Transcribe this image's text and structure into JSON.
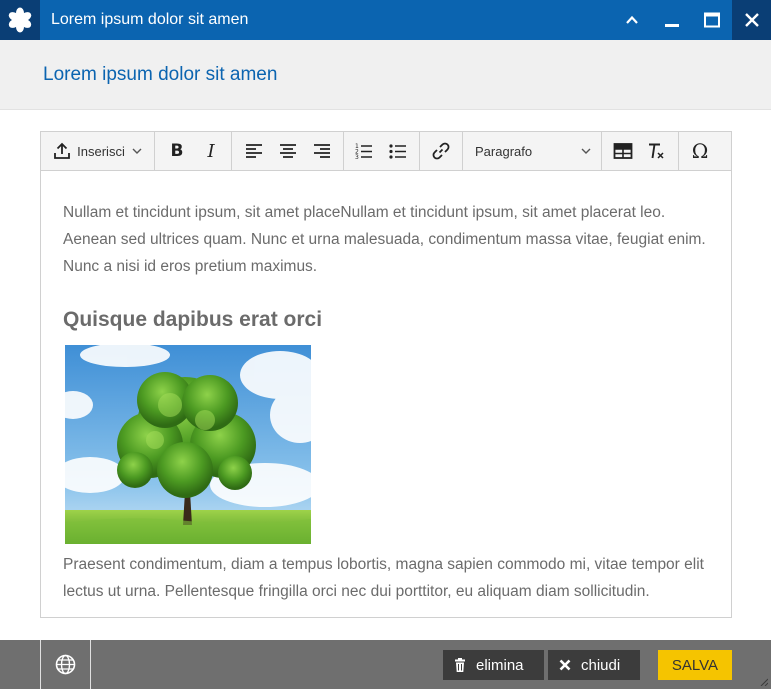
{
  "window": {
    "title": "Lorem ipsum dolor sit amen",
    "logo_icon": "asterisk-logo-icon",
    "controls": [
      "chevron-up-icon",
      "minimize-icon",
      "maximize-icon",
      "close-icon"
    ]
  },
  "header": {
    "title": "Lorem ipsum dolor sit amen"
  },
  "toolbar": {
    "insert_label": "Inserisci",
    "format_label": "Paragrafo"
  },
  "content": {
    "paragraph1": "Nullam et tincidunt ipsum, sit amet placeNullam et tincidunt ipsum, sit amet placerat leo. Aenean sed ultrices quam. Nunc et urna malesuada, condimentum massa vitae, feugiat enim. Nunc a nisi id eros pretium maximus.",
    "heading": "Quisque dapibus erat orci",
    "paragraph2": "Praesent condimentum, diam a tempus lobortis, magna sapien commodo mi, vitae tempor elit lectus ut urna. Pellentesque fringilla orci nec dui porttitor, eu aliquam diam sollicitudin."
  },
  "footer": {
    "delete_label": "elimina",
    "close_label": "chiudi",
    "save_label": "SALVA"
  },
  "colors": {
    "titlebar": "#0b64b0",
    "titlebar_dark": "#0a3e75",
    "accent_text": "#0b64b0",
    "footer": "#6f6f6f",
    "save_button": "#f5c400"
  }
}
